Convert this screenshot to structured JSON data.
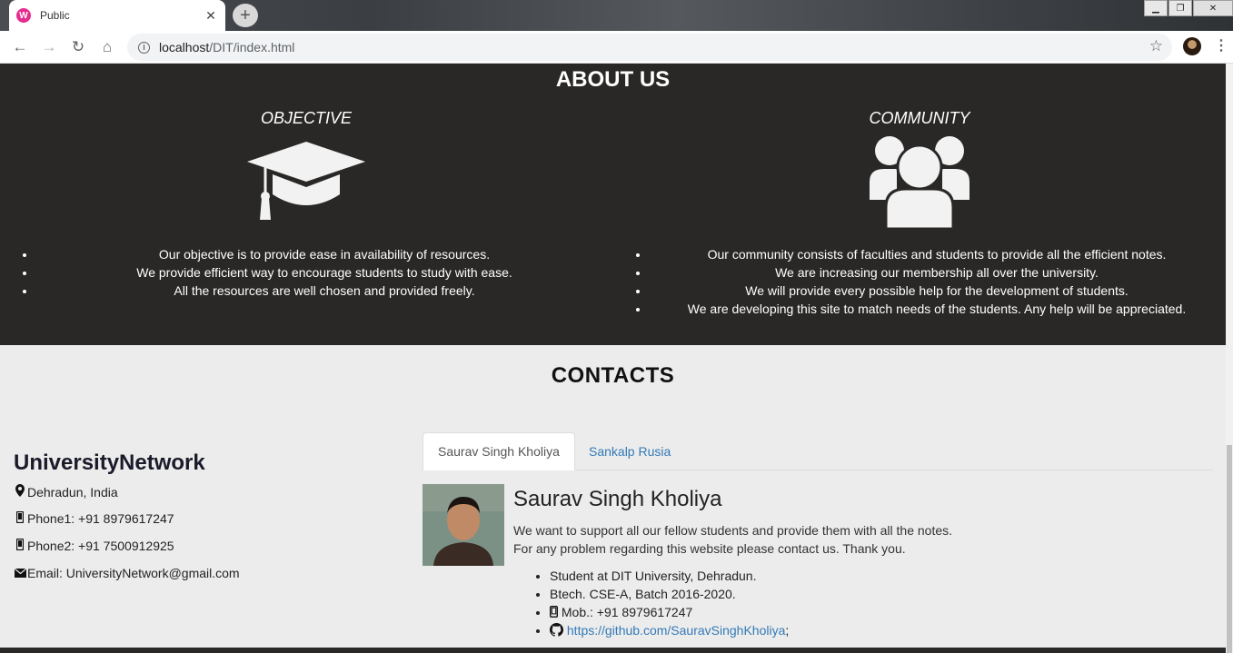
{
  "browser": {
    "tab_title": "Public",
    "favicon_letter": "W",
    "url_host": "localhost",
    "url_path": "/DIT/index.html"
  },
  "about": {
    "title": "ABOUT US",
    "objective": {
      "heading": "OBJECTIVE",
      "icon": "graduation-cap-icon",
      "items": [
        "Our objective is to provide ease in availability of resources.",
        "We provide efficient way to encourage students to study with ease.",
        "All the resources are well chosen and provided freely."
      ]
    },
    "community": {
      "heading": "COMMUNITY",
      "icon": "users-icon",
      "items": [
        "Our community consists of faculties and students to provide all the efficient notes.",
        "We are increasing our membership all over the university.",
        "We will provide every possible help for the development of students.",
        "We are developing this site to match needs of the students. Any help will be appreciated."
      ]
    }
  },
  "contacts": {
    "title": "CONTACTS",
    "brand": "UniversityNetwork",
    "location": "Dehradun, India",
    "phone1": "Phone1: +91 8979617247",
    "phone2": "Phone2: +91 7500912925",
    "email": "Email: UniversityNetwork@gmail.com",
    "tabs": [
      "Saurav Singh Kholiya",
      "Sankalp Rusia"
    ],
    "active_tab": 0,
    "person": {
      "name": "Saurav Singh Kholiya",
      "desc1": "We want to support all our fellow students and provide them with all the notes.",
      "desc2": "For any problem regarding this website please contact us. Thank you.",
      "details": [
        "Student at DIT University, Dehradun.",
        "Btech. CSE-A, Batch 2016-2020.",
        "Mob.: +91 8979617247"
      ],
      "github": "https://github.com/SauravSinghKholiya",
      "github_suffix": ";"
    }
  },
  "colors": {
    "dark_bg": "#292826",
    "light_bg": "#ececec",
    "link": "#337ab7"
  }
}
